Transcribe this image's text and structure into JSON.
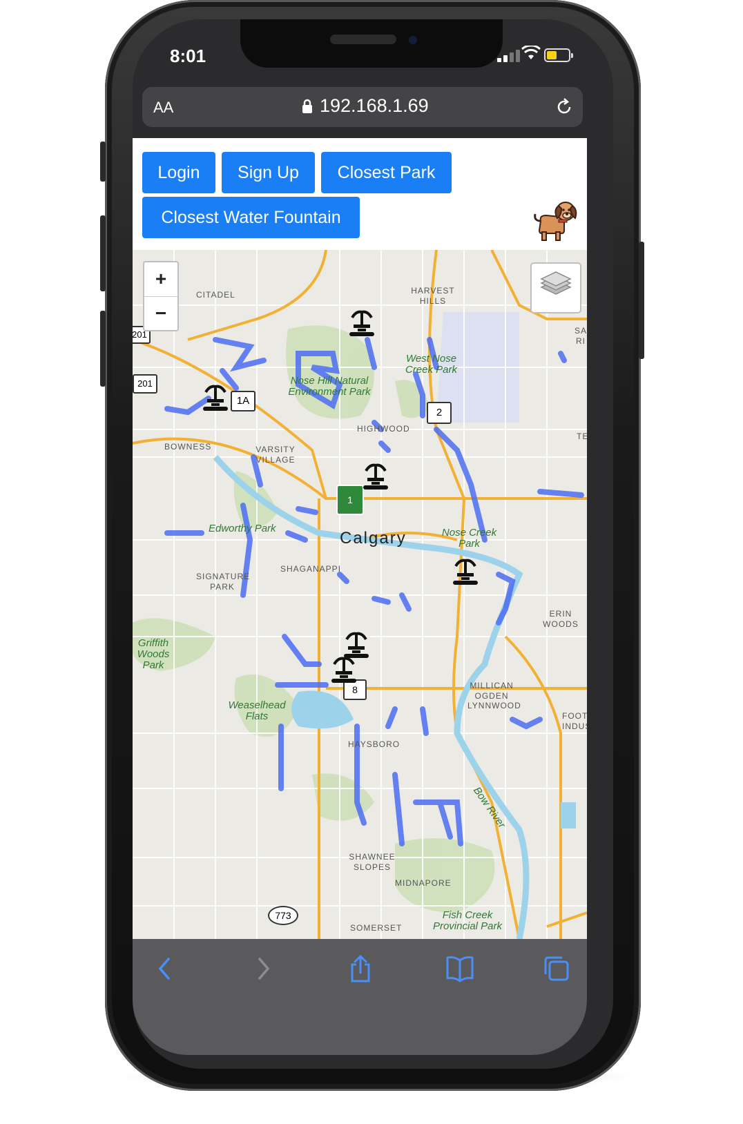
{
  "status_bar": {
    "time": "8:01"
  },
  "browser": {
    "text_size_label": "AA",
    "url": "192.168.1.69"
  },
  "page": {
    "buttons": {
      "login": "Login",
      "sign_up": "Sign Up",
      "closest_park": "Closest Park",
      "closest_water_fountain": "Closest Water Fountain"
    },
    "logo_icon": "dog-icon"
  },
  "map": {
    "zoom_in": "+",
    "zoom_out": "−",
    "city": "Calgary",
    "neighbourhoods": [
      "CITADEL",
      "HARVEST HILLS",
      "HIGHWOOD",
      "BOWNESS",
      "VARSITY VILLAGE",
      "SIGNATURE PARK",
      "SHAGANAPPI",
      "ERIN WOODS",
      "MILLICAN OGDEN",
      "LYNNWOOD",
      "HAYSBORO",
      "SHAWNEE SLOPES",
      "MIDNAPORE",
      "SOMERSET"
    ],
    "parks": [
      "West Nose Creek Park",
      "Nose Hill Natural Environment Park",
      "Edworthy Park",
      "Nose Creek Park",
      "Weaselhead Flats",
      "Fish Creek Provincial Park",
      "Griffith Woods Park"
    ],
    "road_shields": [
      "201",
      "201",
      "1A",
      "2",
      "1",
      "8",
      "773"
    ],
    "river_label": "Bow River",
    "edge_labels": [
      "SA RI",
      "TE",
      "FOOT INDUS"
    ],
    "fountain_icon": "water-fountain-icon",
    "layers_icon": "layers-icon"
  },
  "toolbar": [
    "back-icon",
    "forward-icon",
    "share-icon",
    "bookmarks-icon",
    "tabs-icon"
  ]
}
